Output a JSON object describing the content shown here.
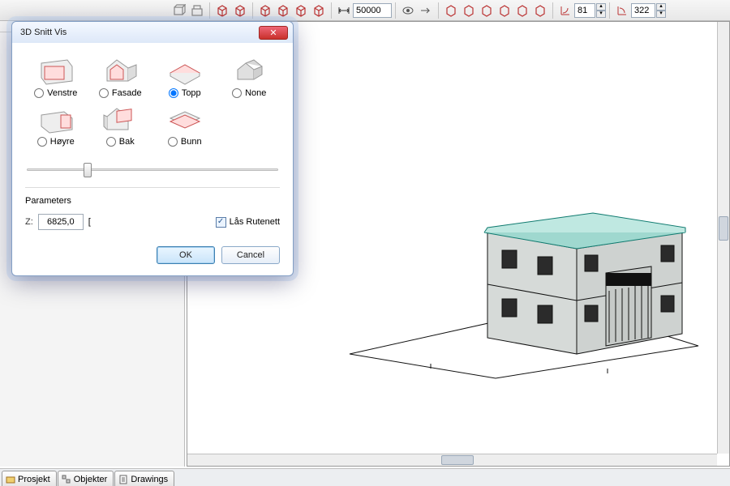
{
  "toolbar": {
    "distance_value": "50000",
    "val1": "81",
    "val2": "322"
  },
  "dialog": {
    "title": "3D Snitt Vis",
    "views": [
      {
        "label": "Venstre",
        "selected": false
      },
      {
        "label": "Fasade",
        "selected": false
      },
      {
        "label": "Topp",
        "selected": true
      },
      {
        "label": "None",
        "selected": false
      },
      {
        "label": "Høyre",
        "selected": false
      },
      {
        "label": "Bak",
        "selected": false
      },
      {
        "label": "Bunn",
        "selected": false
      }
    ],
    "params_heading": "Parameters",
    "z_label": "Z:",
    "z_value": "6825,0",
    "z_bracket": "[",
    "lock_grid_label": "Lås Rutenett",
    "lock_grid_checked": true,
    "ok_label": "OK",
    "cancel_label": "Cancel"
  },
  "bottom_tabs": [
    {
      "label": "Prosjekt"
    },
    {
      "label": "Objekter"
    },
    {
      "label": "Drawings"
    }
  ]
}
